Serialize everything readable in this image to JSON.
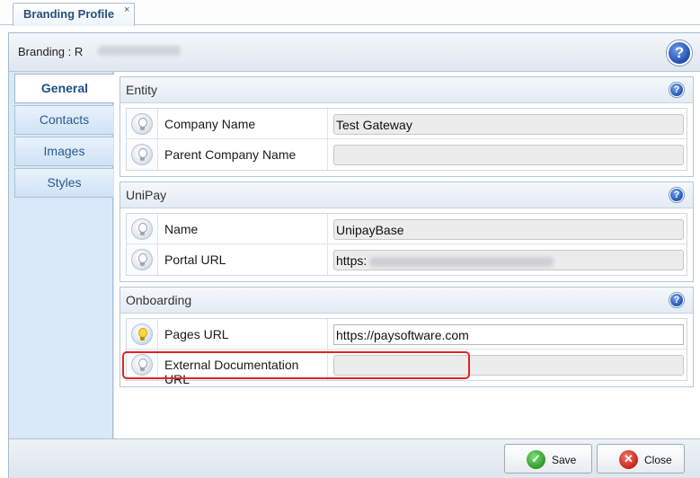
{
  "tab": {
    "title": "Branding Profile",
    "close_glyph": "×"
  },
  "header": {
    "title": "Branding : R",
    "help_icon": "help-icon"
  },
  "nav": {
    "items": [
      {
        "label": "General",
        "active": true
      },
      {
        "label": "Contacts",
        "active": false
      },
      {
        "label": "Images",
        "active": false
      },
      {
        "label": "Styles",
        "active": false
      }
    ]
  },
  "sections": {
    "entity": {
      "title": "Entity",
      "rows": [
        {
          "label": "Company Name",
          "value": "Test Gateway"
        },
        {
          "label": "Parent Company Name",
          "value": ""
        }
      ]
    },
    "unipay": {
      "title": "UniPay",
      "rows": [
        {
          "label": "Name",
          "value": "UnipayBase"
        },
        {
          "label": "Portal URL",
          "value": "https:"
        }
      ]
    },
    "onboarding": {
      "title": "Onboarding",
      "rows": [
        {
          "label": "Pages URL",
          "value": "https://paysoftware.com"
        },
        {
          "label": "External Documentation URL",
          "value": ""
        }
      ]
    }
  },
  "footer": {
    "save_label": "Save",
    "close_label": "Close"
  },
  "colors": {
    "accent": "#264f7c",
    "highlight": "#e02424"
  }
}
